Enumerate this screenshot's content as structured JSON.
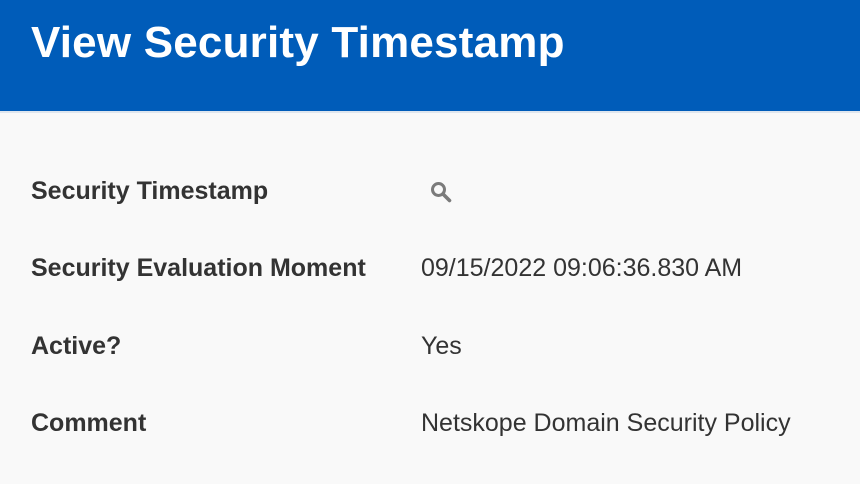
{
  "header": {
    "title": "View Security Timestamp",
    "background_color": "#005cb9"
  },
  "fields": [
    {
      "label": "Security Timestamp",
      "value": "",
      "icon": "search-icon"
    },
    {
      "label": "Security Evaluation Moment",
      "value": "09/15/2022 09:06:36.830 AM"
    },
    {
      "label": "Active?",
      "value": "Yes"
    },
    {
      "label": "Comment",
      "value": "Netskope Domain Security Policy"
    }
  ]
}
